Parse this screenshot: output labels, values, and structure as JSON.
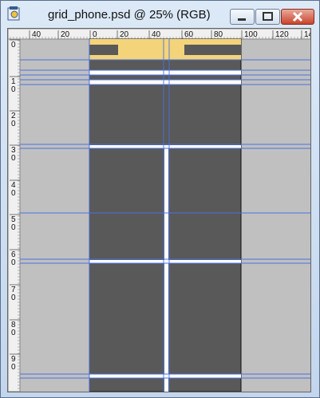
{
  "window": {
    "title": "grid_phone.psd @ 25% (RGB)",
    "app_icon": "photoshop-document-icon",
    "controls": [
      "minimize-icon",
      "maximize-icon",
      "close-icon"
    ]
  },
  "rulers": {
    "top_labels": [
      "40",
      "20",
      "0",
      "20",
      "40",
      "60",
      "80",
      "100",
      "120",
      "14"
    ],
    "left_labels": [
      [
        "0"
      ],
      [
        "1",
        "0"
      ],
      [
        "2",
        "0"
      ],
      [
        "3",
        "0"
      ],
      [
        "4",
        "0"
      ],
      [
        "5",
        "0"
      ],
      [
        "6",
        "0"
      ],
      [
        "7",
        "0"
      ],
      [
        "8",
        "0"
      ],
      [
        "9",
        "0"
      ]
    ]
  },
  "colors": {
    "pasteboard": "#c0c0c0",
    "doc_dark": "#595959",
    "status_bar": "#f3d47a",
    "guide": "#4a72e0",
    "gutter": "#ffffff",
    "title_close": "#c9442d"
  }
}
